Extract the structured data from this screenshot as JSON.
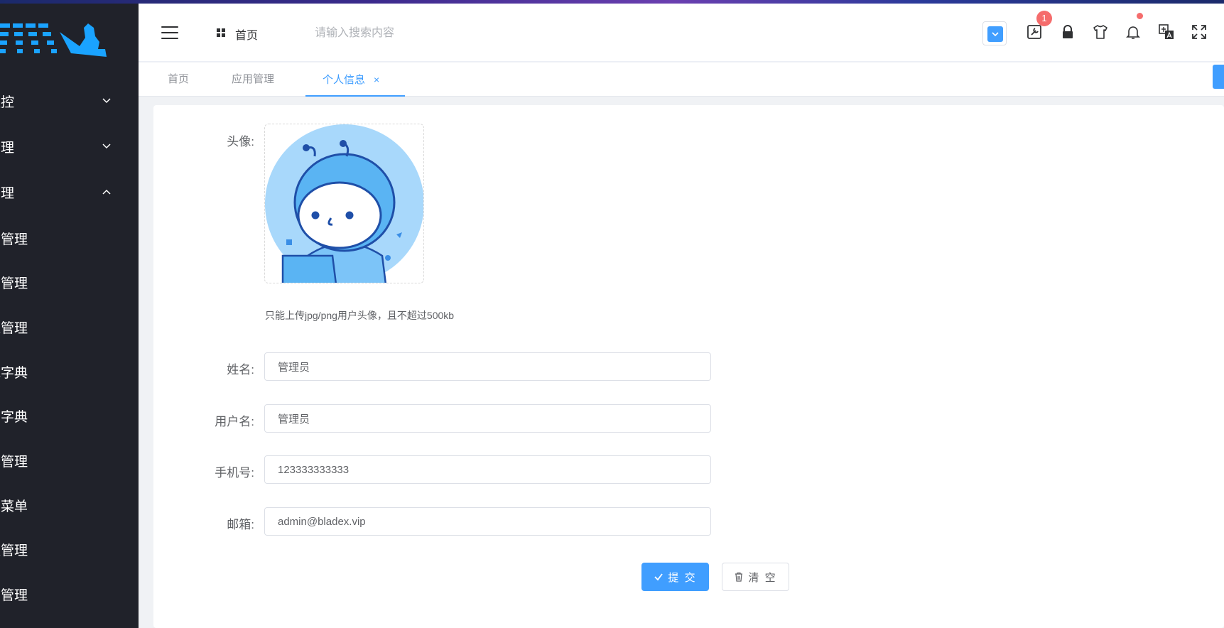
{
  "sidebar": {
    "items": [
      {
        "label": "监控",
        "chevron": "down"
      },
      {
        "label": "管理",
        "chevron": "down"
      },
      {
        "label": "管理",
        "chevron": "up"
      },
      {
        "label": "户管理"
      },
      {
        "label": "构管理"
      },
      {
        "label": "位管理"
      },
      {
        "label": "统字典"
      },
      {
        "label": "务字典"
      },
      {
        "label": "单管理"
      },
      {
        "label": "部菜单"
      },
      {
        "label": "数管理"
      },
      {
        "label": "户管理"
      }
    ]
  },
  "header": {
    "home_label": "首页",
    "search_placeholder": "请输入搜索内容",
    "badge_count": "1",
    "icons": [
      "menu-icon",
      "grid-icon",
      "select-icon",
      "tool-icon",
      "lock-icon",
      "theme-shirt-icon",
      "bell-icon",
      "translate-icon",
      "fullscreen-icon"
    ]
  },
  "tabs": [
    {
      "label": "首页",
      "active": false
    },
    {
      "label": "应用管理",
      "active": false
    },
    {
      "label": "个人信息",
      "active": true,
      "close": "×"
    }
  ],
  "form": {
    "avatar_label": "头像:",
    "avatar_tip": "只能上传jpg/png用户头像，且不超过500kb",
    "name_label": "姓名:",
    "name_value": "管理员",
    "username_label": "用户名:",
    "username_value": "管理员",
    "phone_label": "手机号:",
    "phone_value": "123333333333",
    "email_label": "邮箱:",
    "email_value": "admin@bladex.vip",
    "submit_label": "提 交",
    "clear_label": "清 空"
  },
  "colors": {
    "primary": "#409eff",
    "sidebar_bg": "#20222a",
    "badge": "#f56c6c"
  }
}
